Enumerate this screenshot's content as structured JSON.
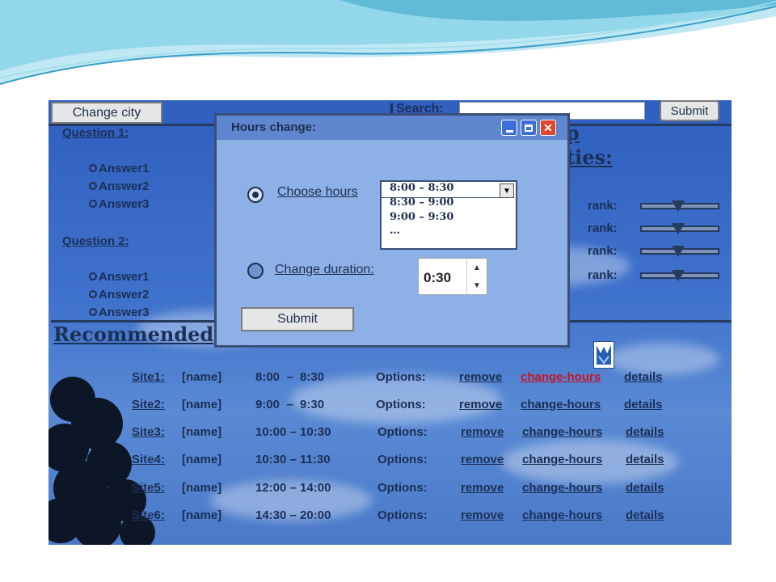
{
  "toolbar": {
    "change_city": "Change city",
    "search_label": "Search:",
    "search_value": "",
    "submit": "Submit"
  },
  "questions": [
    {
      "label": "Question 1:",
      "answers": [
        "Answer1",
        "Answer2",
        "Answer3"
      ]
    },
    {
      "label": "Question 2:",
      "answers": [
        "Answer1",
        "Answer2",
        "Answer3"
      ]
    }
  ],
  "partial_heading_top": "p",
  "partial_heading": "ties:",
  "ranks": [
    "rank:",
    "rank:",
    "rank:",
    "rank:"
  ],
  "recommended_heading": "Recommended",
  "sites": [
    {
      "site": "Site1:",
      "name": "[name]",
      "time": "8:00  –  8:30",
      "options": "Options:",
      "remove": "remove",
      "change": "change-hours",
      "details": "details"
    },
    {
      "site": "Site2:",
      "name": "[name]",
      "time": "9:00  –  9:30",
      "options": "Options:",
      "remove": "remove",
      "change": "change-hours",
      "details": "details"
    },
    {
      "site": "Site3:",
      "name": "[name]",
      "time": "10:00 – 10:30",
      "options": "Options:",
      "remove": "remove",
      "change": "change-hours",
      "details": "details"
    },
    {
      "site": "Site4:",
      "name": "[name]",
      "time": "10:30 – 11:30",
      "options": "Options:",
      "remove": "remove",
      "change": "change-hours",
      "details": "details"
    },
    {
      "site": "Site5:",
      "name": "[name]",
      "time": "12:00 – 14:00",
      "options": "Options:",
      "remove": "remove",
      "change": "change-hours",
      "details": "details"
    },
    {
      "site": "Site6:",
      "name": "[name]",
      "time": "14:30 – 20:00",
      "options": "Options:",
      "remove": "remove",
      "change": "change-hours",
      "details": "details"
    }
  ],
  "dialog": {
    "title": "Hours change:",
    "choose_hours": "Choose hours",
    "hour_options": [
      "8:00 – 8:30",
      "8:30 – 9:00",
      "9:00 – 9:30",
      "…"
    ],
    "change_duration": "Change duration:",
    "duration_value": "0:30",
    "submit": "Submit"
  },
  "colors": {
    "highlight_link": "#c4162a",
    "dialog_bg": "#8db0e6",
    "title_bar": "#5f86cf"
  },
  "icons": [
    "minimize-icon",
    "maximize-icon",
    "close-icon",
    "dropdown-arrow-icon",
    "spin-up-icon",
    "spin-down-icon",
    "radio-icon",
    "app-logo-icon"
  ]
}
